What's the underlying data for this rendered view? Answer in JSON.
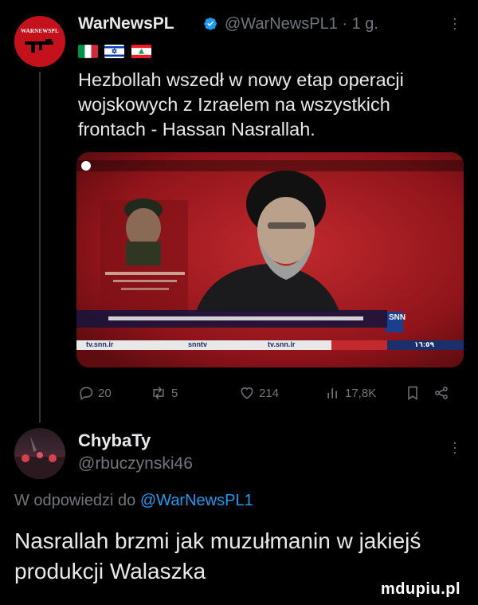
{
  "tweet": {
    "avatar_logo_text": "WARNEWSPL",
    "author_name": "WarNewsPL",
    "handle": "@WarNewsPL1",
    "separator": "·",
    "time": "1 g.",
    "flags": [
      "flag-italy",
      "flag-israel",
      "flag-lebanon"
    ],
    "text": "Hezbollah wszedł w nowy etap operacji wojskowych z Izraelem na wszystkich frontach - Hassan Nasrallah.",
    "media": {
      "kind": "tv-screenshot",
      "logo": "SNN",
      "ticker_time": "١٦:٥٩",
      "bottom_bar": [
        "tv.snn.ir",
        "snntv",
        "tv.snn.ir"
      ]
    },
    "actions": {
      "replies": "20",
      "retweets": "5",
      "likes": "214",
      "views": "17,8K"
    }
  },
  "reply": {
    "author_name": "ChybaTy",
    "handle": "@rbuczynski46",
    "in_reply_prefix": "W odpowiedzi do ",
    "in_reply_mention": "@WarNewsPL1",
    "text": "Nasrallah brzmi jak muzułmanin w jakiejś produkcji Walaszka"
  },
  "watermark": "mdupiu.pl",
  "colors": {
    "background": "#000000",
    "text": "#e7e9ea",
    "muted": "#71767b",
    "accent": "#1d9bf0",
    "brand": "#c4111b"
  }
}
